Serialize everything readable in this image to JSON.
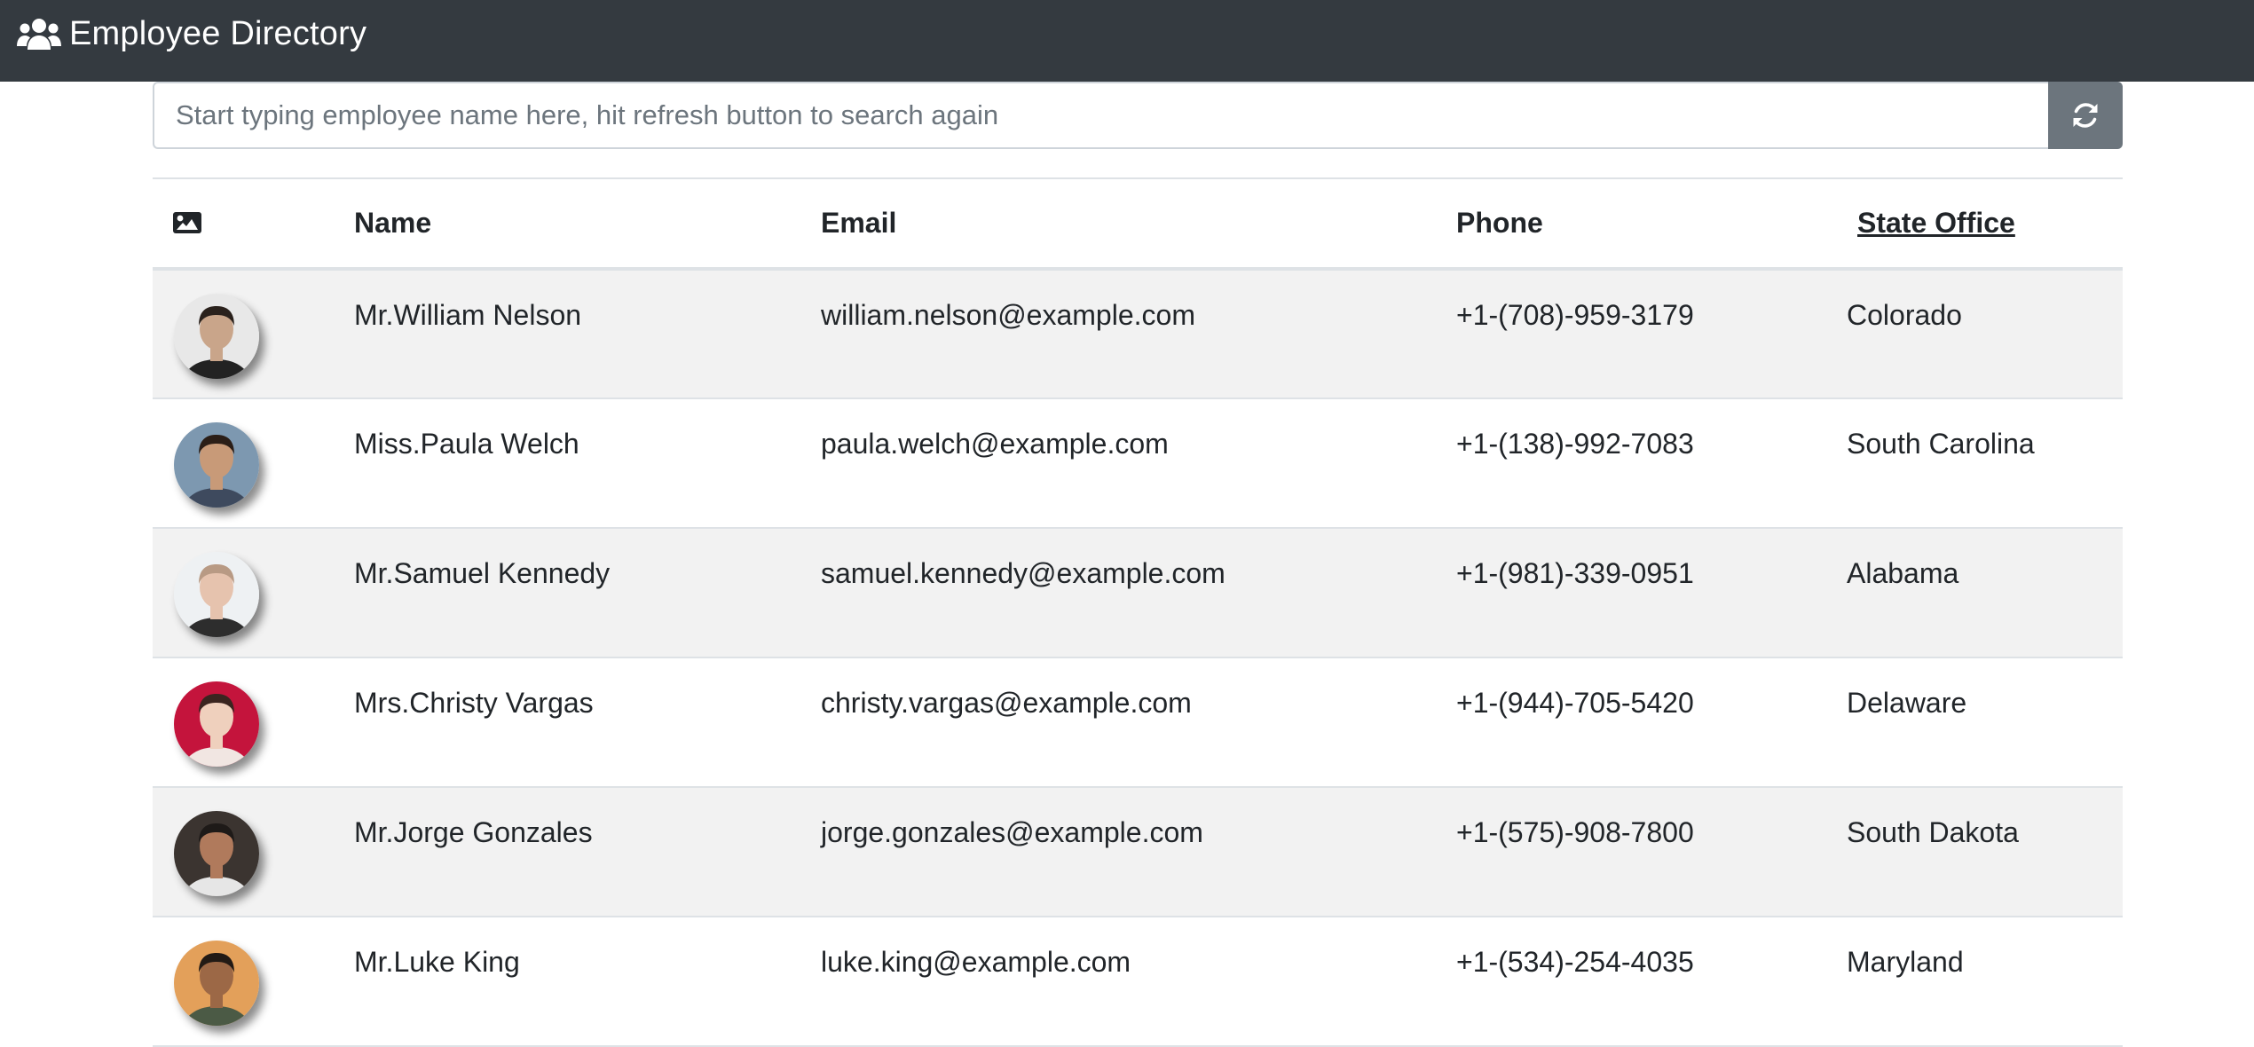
{
  "navbar": {
    "title": "Employee Directory",
    "icon": "users-icon"
  },
  "search": {
    "placeholder": "Start typing employee name here, hit refresh button to search again",
    "value": "",
    "refresh_icon": "sync-icon"
  },
  "table": {
    "headers": {
      "image_icon": "image-icon",
      "name": "Name",
      "email": "Email",
      "phone": "Phone",
      "state": "State Office"
    },
    "rows": [
      {
        "name": "Mr.William Nelson",
        "email": "william.nelson@example.com",
        "phone": "+1-(708)-959-3179",
        "state": "Colorado",
        "avatar_bg": "#e8e8e8",
        "avatar_skin": "#c9a58a",
        "avatar_hair": "#2a211c",
        "avatar_shirt": "#222222"
      },
      {
        "name": "Miss.Paula Welch",
        "email": "paula.welch@example.com",
        "phone": "+1-(138)-992-7083",
        "state": "South Carolina",
        "avatar_bg": "#7d98b0",
        "avatar_skin": "#c89a78",
        "avatar_hair": "#2b1e17",
        "avatar_shirt": "#3e4a5e"
      },
      {
        "name": "Mr.Samuel Kennedy",
        "email": "samuel.kennedy@example.com",
        "phone": "+1-(981)-339-0951",
        "state": "Alabama",
        "avatar_bg": "#eef1f3",
        "avatar_skin": "#e6c3ae",
        "avatar_hair": "#b89a84",
        "avatar_shirt": "#2d2d2d"
      },
      {
        "name": "Mrs.Christy Vargas",
        "email": "christy.vargas@example.com",
        "phone": "+1-(944)-705-5420",
        "state": "Delaware",
        "avatar_bg": "#c4143c",
        "avatar_skin": "#efd0bd",
        "avatar_hair": "#3a2520",
        "avatar_shirt": "#f1e6e2"
      },
      {
        "name": "Mr.Jorge Gonzales",
        "email": "jorge.gonzales@example.com",
        "phone": "+1-(575)-908-7800",
        "state": "South Dakota",
        "avatar_bg": "#3b3430",
        "avatar_skin": "#b07a5c",
        "avatar_hair": "#1e1a18",
        "avatar_shirt": "#e6e6e6"
      },
      {
        "name": "Mr.Luke King",
        "email": "luke.king@example.com",
        "phone": "+1-(534)-254-4035",
        "state": "Maryland",
        "avatar_bg": "#e3a05a",
        "avatar_skin": "#9c6846",
        "avatar_hair": "#221a15",
        "avatar_shirt": "#4b5a45"
      }
    ]
  },
  "colors": {
    "navbar": "#343a40",
    "refresh_button": "#6c757d",
    "stripe": "#f2f2f2",
    "border": "#dee2e6"
  }
}
